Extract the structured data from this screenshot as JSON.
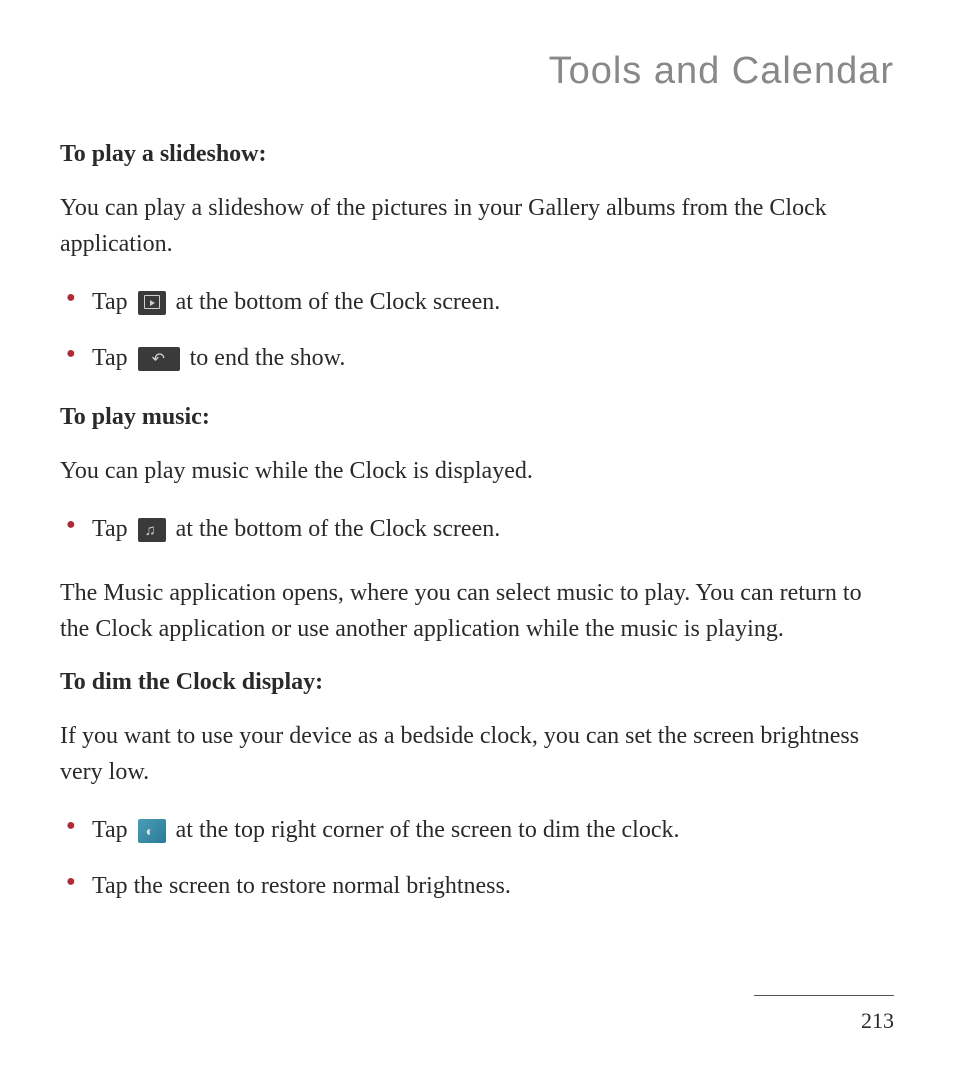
{
  "page": {
    "title": "Tools and Calendar",
    "number": "213"
  },
  "sections": [
    {
      "heading": "To play a slideshow:",
      "intro": "You can play a slideshow of the pictures in your Gallery albums from the Clock application.",
      "bullets": [
        {
          "pre": "Tap ",
          "icon": "slideshow-icon",
          "post": " at the bottom of the Clock screen."
        },
        {
          "pre": "Tap ",
          "icon": "back-icon",
          "post": " to end the show."
        }
      ]
    },
    {
      "heading": "To play music:",
      "intro": "You can play music while the Clock is displayed.",
      "bullets": [
        {
          "pre": "Tap ",
          "icon": "music-icon",
          "post": " at the bottom of the Clock screen."
        }
      ],
      "outro": "The Music application opens, where you can select music to play. You can return to the Clock application or use another application while the music is playing."
    },
    {
      "heading": "To dim the Clock display:",
      "intro": "If you want to use your device as a bedside clock, you can set the screen brightness very low.",
      "bullets": [
        {
          "pre": "Tap ",
          "icon": "dim-icon",
          "post": " at the top right corner of the screen to dim the clock."
        },
        {
          "pre": "Tap the screen to restore normal brightness.",
          "icon": null,
          "post": ""
        }
      ]
    }
  ]
}
